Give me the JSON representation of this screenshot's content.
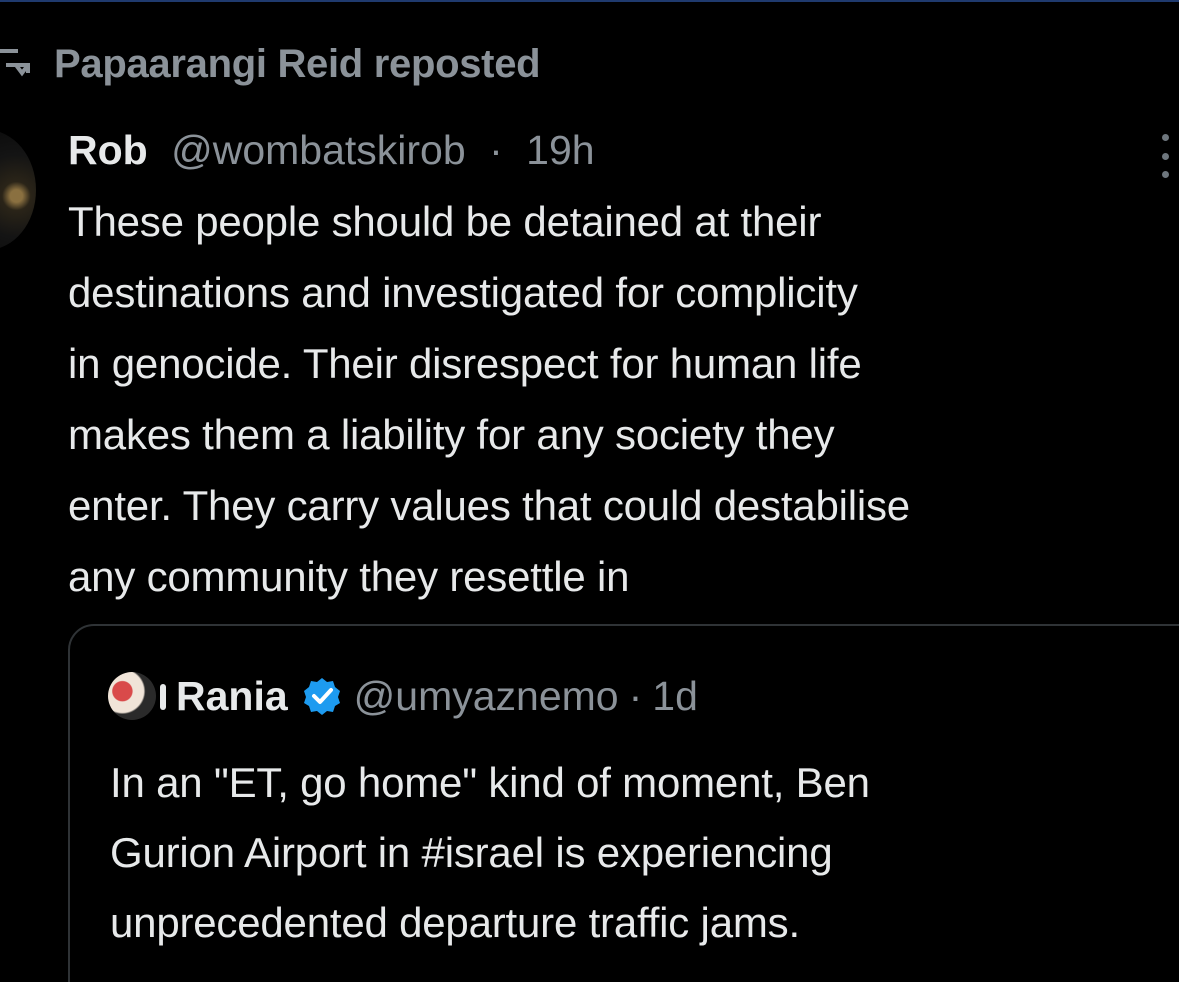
{
  "repost": {
    "icon": "repost-icon",
    "text": "Papaarangi Reid reposted"
  },
  "tweet": {
    "author_name": "Rob",
    "handle": "@wombatskirob",
    "separator": "·",
    "time": "19h",
    "more_icon": "more-vertical-icon",
    "lines": [
      "These people should be detained at their",
      "destinations and investigated for complicity",
      "in genocide. Their disrespect for human life",
      "makes them a liability for any society they",
      "enter. They carry values that could destabilise",
      "any community they resettle in"
    ]
  },
  "quote": {
    "author_name": "Rania",
    "verified_icon": "verified-badge-icon",
    "handle": "@umyaznemo",
    "separator": "·",
    "time": "1d",
    "lines": [
      "In an \"ET, go home\" kind of moment, Ben",
      "Gurion Airport in #israel is experiencing",
      "unprecedented departure traffic jams."
    ]
  },
  "colors": {
    "background": "#000000",
    "primary_text": "#e7e9ea",
    "secondary_text": "#8b9299",
    "card_border": "#2f3336",
    "verified": "#1d9bf0"
  }
}
